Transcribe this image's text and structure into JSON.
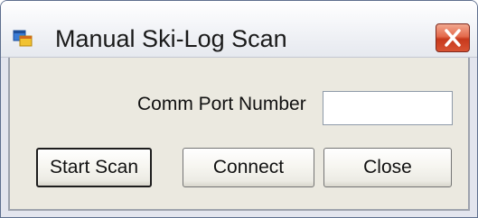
{
  "window": {
    "title": "Manual Ski-Log Scan",
    "app_icon": "application-window-icon",
    "close_icon": "close-x-icon",
    "colors": {
      "close_button": "#d85333",
      "titlebar": "#f5f6f9",
      "client_area": "#ebe9e0"
    }
  },
  "form": {
    "port_label": "Comm Port Number",
    "port_value": "",
    "port_placeholder": ""
  },
  "buttons": {
    "start_scan": "Start Scan",
    "connect": "Connect",
    "close": "Close"
  }
}
